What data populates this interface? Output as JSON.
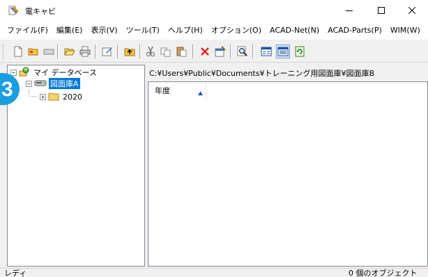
{
  "window": {
    "title": "電キャビ"
  },
  "menu": [
    "ファイル(F)",
    "編集(E)",
    "表示(V)",
    "ツール(T)",
    "ヘルプ(H)",
    "オプション(O)",
    "ACAD-Net(N)",
    "ACAD-Parts(P)",
    "WIM(W)"
  ],
  "toolbar": {
    "icons": [
      "new-icon",
      "open-folder-icon",
      "close-folder-icon",
      "folder-open-icon",
      "print-icon",
      "edit-icon",
      "up-folder-icon",
      "cut-icon",
      "copy-icon",
      "paste-icon",
      "delete-icon",
      "properties-icon",
      "search-icon",
      "view-list-icon",
      "view-detail-icon",
      "refresh-icon"
    ]
  },
  "tree": {
    "root": "マイ データベース",
    "drive": "図面庫A",
    "folder": "2020"
  },
  "badge": "3",
  "path": "C:¥Users¥Public¥Documents¥トレーニング用図面庫¥図面庫B",
  "list": {
    "columns": [
      "年度"
    ]
  },
  "status": {
    "left": "レディ",
    "right": "0 個のオブジェクト"
  },
  "colors": {
    "selection": "#0078d7",
    "badge": "#1a9ee0",
    "folder": "#f5d36b",
    "delete": "#e02020"
  }
}
